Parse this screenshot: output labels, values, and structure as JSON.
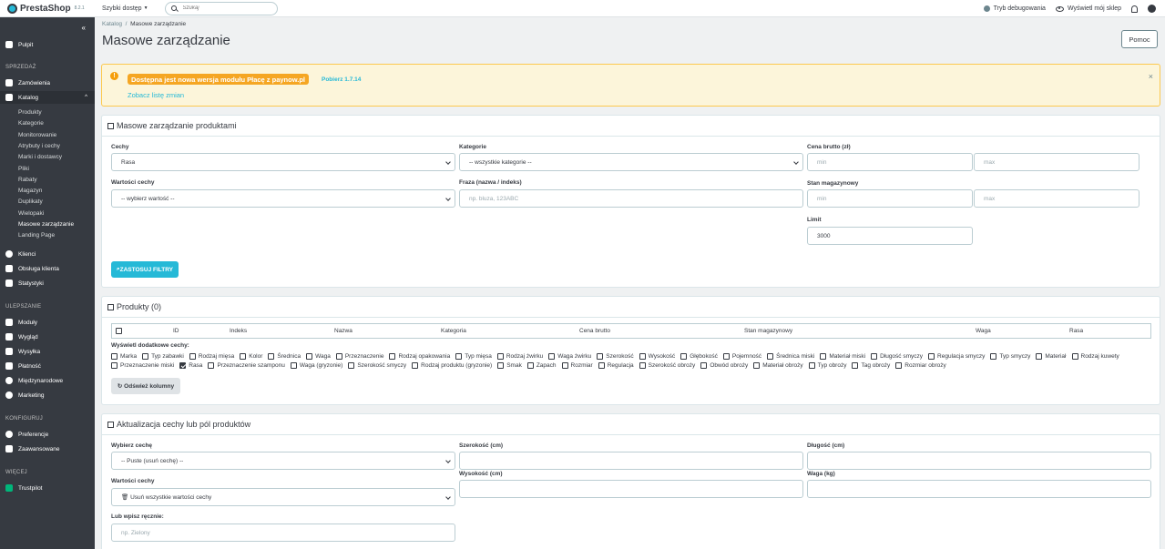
{
  "topbar": {
    "logo": "PrestaShop",
    "version": "8.2.1",
    "quick_access": "Szybki dostęp",
    "search_placeholder": "Szukaj",
    "debug": "Tryb debugowania",
    "view_shop": "Wyświetl mój sklep"
  },
  "sidebar": {
    "dashboard": "Pulpit",
    "section_sell": "SPRZEDAŻ",
    "orders": "Zamówienia",
    "catalog": "Katalog",
    "catalog_sub": [
      "Produkty",
      "Kategorie",
      "Monitorowanie",
      "Atrybuty i cechy",
      "Marki i dostawcy",
      "Pliki",
      "Rabaty",
      "Magazyn",
      "Duplikaty",
      "Wielopaki",
      "Masowe zarządzanie",
      "Landing Page"
    ],
    "clients": "Klienci",
    "customer_service": "Obsługa klienta",
    "stats": "Statystyki",
    "section_improve": "ULEPSZANIE",
    "modules": "Moduły",
    "design": "Wygląd",
    "shipping": "Wysyłka",
    "payment": "Płatność",
    "international": "Międzynarodowe",
    "marketing": "Marketing",
    "section_config": "KONFIGURUJ",
    "preferences": "Preferencje",
    "advanced": "Zaawansowane",
    "section_more": "WIĘCEJ",
    "trustpilot": "Trustpilot"
  },
  "header": {
    "breadcrumb_parent": "Katalog",
    "breadcrumb_sep": "/",
    "breadcrumb_current": "Masowe zarządzanie",
    "title": "Masowe zarządzanie",
    "help": "Pomoc"
  },
  "alert": {
    "message": "Dostępna jest nowa wersja modułu Płacę z paynow.pl",
    "download": "Pobierz 1.7.14",
    "changes": "Zobacz listę zmian",
    "close": "×"
  },
  "filters": {
    "title": "Masowe zarządzanie produktami",
    "feature_label": "Cechy",
    "feature_value": "Rasa",
    "category_label": "Kategorie",
    "category_value": "-- wszystkie kategorie --",
    "price_label": "Cena brutto (zł)",
    "min": "min",
    "max": "max",
    "feature_values_label": "Wartości cechy",
    "feature_values_value": "-- wybierz wartość --",
    "phrase_label": "Fraza (nazwa / indeks)",
    "phrase_placeholder": "np. bluza, 123ABC",
    "stock_label": "Stan magazynowy",
    "limit_label": "Limit",
    "limit_value": "3000",
    "apply": "ZASTOSUJ FILTRY"
  },
  "products": {
    "title": "Produkty (0)",
    "columns": [
      "ID",
      "Indeks",
      "Nazwa",
      "Kategoria",
      "Cena brutto",
      "Stan magazynowy",
      "Waga",
      "Rasa"
    ],
    "extra_label": "Wyświetl dodatkowe cechy:",
    "row1": [
      "Marka",
      "Typ zabawki",
      "Rodzaj mięsa",
      "Kolor",
      "Średnica",
      "Waga",
      "Przeznaczenie",
      "Rodzaj opakowania",
      "Typ mięsa",
      "Rodzaj żwirku",
      "Waga żwirku",
      "Szerokość",
      "Wysokość",
      "Głębokość",
      "Pojemność",
      "Średnica miski",
      "Materiał miski",
      "Długość smyczy",
      "Regulacja smyczy",
      "Typ smyczy",
      "Materiał",
      "Rodzaj kuwety"
    ],
    "row2": [
      "Przeznaczenie miski",
      "Rasa",
      "Przeznaczenie szamponu",
      "Waga (gryzonie)",
      "Szerokość smyczy",
      "Rodzaj produktu (gryzonie)",
      "Smak",
      "Zapach",
      "Rozmiar",
      "Regulacja",
      "Szerokość obroży",
      "Obwód obroży",
      "Materiał obroży",
      "Typ obroży",
      "Tag obroży",
      "Rozmiar obroży"
    ],
    "refresh": "Odśwież kolumny"
  },
  "update": {
    "title": "Aktualizacja cechy lub pól produktów",
    "choose_label": "Wybierz cechę",
    "choose_value": "-- Puste (usuń cechę) --",
    "values_label": "Wartości cechy",
    "values_value": "Usuń wszystkie wartości cechy",
    "manual_label": "Lub wpisz ręcznie:",
    "manual_placeholder": "np. Zielony",
    "width_label": "Szerokość (cm)",
    "height_label": "Wysokość (cm)",
    "length_label": "Długość (cm)",
    "weight_label": "Waga (kg)"
  }
}
